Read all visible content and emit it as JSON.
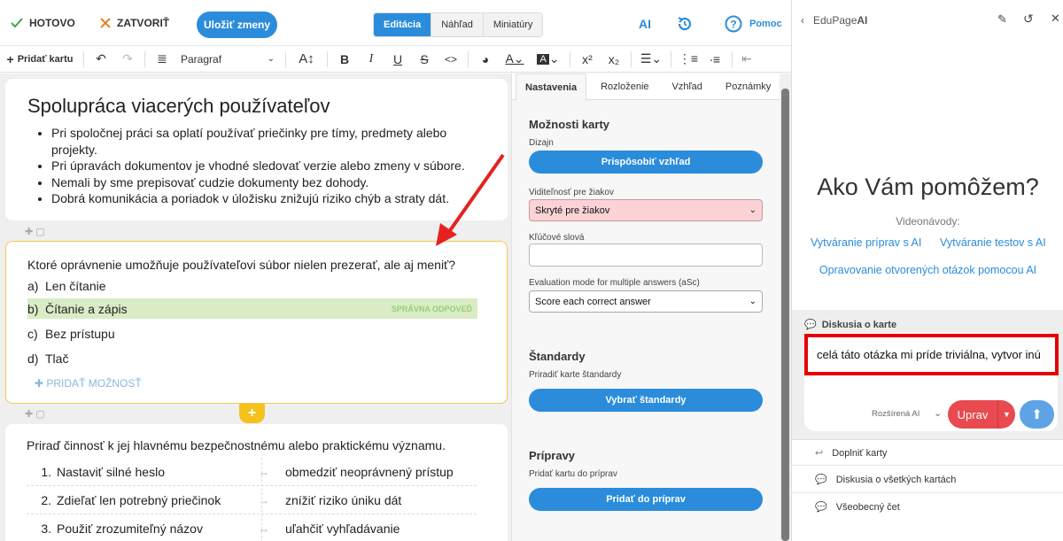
{
  "topbar": {
    "done": "HOTOVO",
    "close": "ZATVORIŤ",
    "save": "Uložiť zmeny",
    "tabs": [
      "Editácia",
      "Náhľad",
      "Miniatúry"
    ],
    "ai": "AI",
    "help": "Pomoc"
  },
  "toolbar": {
    "add_card": "Pridať kartu",
    "paragraph": "Paragraf"
  },
  "card1": {
    "title": "Spolupráca viacerých používateľov",
    "bullets": [
      "Pri spoločnej práci sa oplatí používať priečinky pre tímy, predmety alebo projekty.",
      "Pri úpravách dokumentov je vhodné sledovať verzie alebo zmeny v súbore.",
      "Nemali by sme prepisovať cudzie dokumenty bez dohody.",
      "Dobrá komunikácia a poriadok v úložisku znižujú riziko chýb a straty dát."
    ]
  },
  "card2": {
    "question": "Ktoré oprávnenie umožňuje používateľovi súbor nielen prezerať, ale aj meniť?",
    "options": [
      {
        "letter": "a)",
        "text": "Len čítanie"
      },
      {
        "letter": "b)",
        "text": "Čítanie a zápis"
      },
      {
        "letter": "c)",
        "text": "Bez prístupu"
      },
      {
        "letter": "d)",
        "text": "Tlač"
      }
    ],
    "correct_label": "SPRÁVNA ODPOVEĎ",
    "add_option": "PRIDAŤ MOŽNOSŤ"
  },
  "card3": {
    "question": "Priraď činnosť k jej hlavnému bezpečnostnému alebo praktickému významu.",
    "pairs": [
      {
        "n": "1.",
        "left": "Nastaviť silné heslo",
        "right": "obmedziť neoprávnený prístup"
      },
      {
        "n": "2.",
        "left": "Zdieľať len potrebný priečinok",
        "right": "znížiť riziko úniku dát"
      },
      {
        "n": "3.",
        "left": "Použiť zrozumiteľný názov",
        "right": "uľahčiť vyhľadávanie"
      }
    ]
  },
  "panel": {
    "tabs": [
      "Nastavenia",
      "Rozloženie",
      "Vzhľad",
      "Poznámky"
    ],
    "options_title": "Možnosti karty",
    "design_label": "Dizajn",
    "customize": "Prispôsobiť vzhľad",
    "visibility_label": "Viditeľnosť pre žiakov",
    "visibility_value": "Skryté pre žiakov",
    "keywords_label": "Kľúčové slová",
    "keywords_value": "",
    "eval_label": "Evaluation mode for multiple answers (aSc)",
    "eval_value": "Score each correct answer",
    "standards_title": "Štandardy",
    "standards_label": "Priradiť karte štandardy",
    "standards_btn": "Vybrať štandardy",
    "prep_title": "Prípravy",
    "prep_label": "Pridať kartu do príprav",
    "prep_btn": "Pridať do príprav"
  },
  "ai_panel": {
    "title_prefix": "EduPage",
    "title_suffix": "AI",
    "heading": "Ako Vám pomôžem?",
    "videos_label": "Videonávody:",
    "links": [
      "Vytváranie príprav s AI",
      "Vytváranie testov s AI",
      "Opravovanie otvorených otázok pomocou AI"
    ],
    "discussion_label": "Diskusia o karte",
    "input_text": "celá táto otázka mi príde triviálna, vytvor inú",
    "mode": "Rozšírená AI",
    "edit_btn": "Uprav",
    "chips": [
      "Doplniť karty",
      "Diskusia o všetkých kartách",
      "Všeobecný čet"
    ]
  },
  "colors": {
    "accent": "#2b8cdb",
    "correct_bg": "#d9ecc5",
    "highlight_border": "#e60000",
    "pink_select": "#fbd3d6",
    "red_btn": "#e94a4f"
  }
}
